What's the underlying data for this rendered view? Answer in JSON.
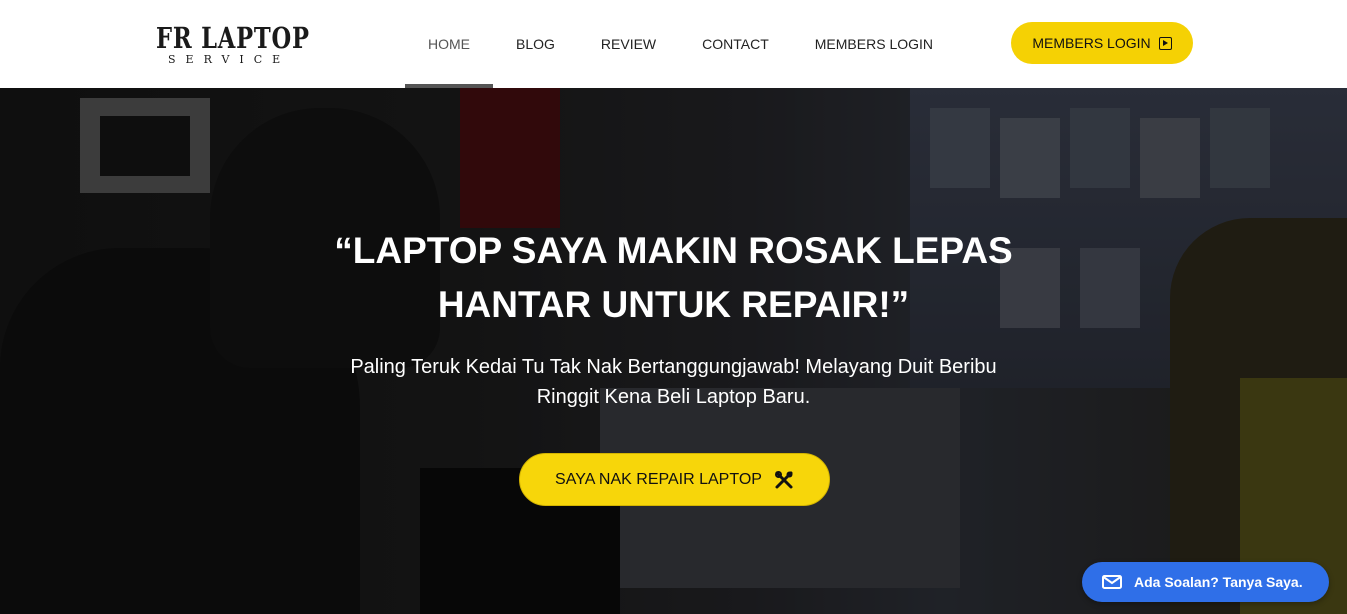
{
  "logo": {
    "title": "FR LAPTOP",
    "subtitle": "SERVICE",
    "monogram": "FR"
  },
  "nav": {
    "items": [
      {
        "label": "HOME",
        "active": true
      },
      {
        "label": "BLOG"
      },
      {
        "label": "REVIEW"
      },
      {
        "label": "CONTACT"
      },
      {
        "label": "MEMBERS LOGIN"
      }
    ]
  },
  "header_cta": {
    "label": "MEMBERS LOGIN",
    "icon": "sign-in-icon"
  },
  "hero": {
    "headline_line1": "“LAPTOP SAYA MAKIN ROSAK LEPAS",
    "headline_line2": "HANTAR UNTUK REPAIR!”",
    "subline_line1": "Paling Teruk Kedai Tu Tak Nak Bertanggungjawab! Melayang Duit Beribu",
    "subline_line2": "Ringgit Kena Beli Laptop Baru.",
    "button_label": "SAYA NAK REPAIR LAPTOP",
    "button_icon": "tools-icon"
  },
  "chat": {
    "label": "Ada Soalan? Tanya Saya.",
    "icon": "mail-icon"
  },
  "colors": {
    "accent": "#f5d104",
    "chat": "#2f6fe8",
    "nav_active": "#555555"
  }
}
